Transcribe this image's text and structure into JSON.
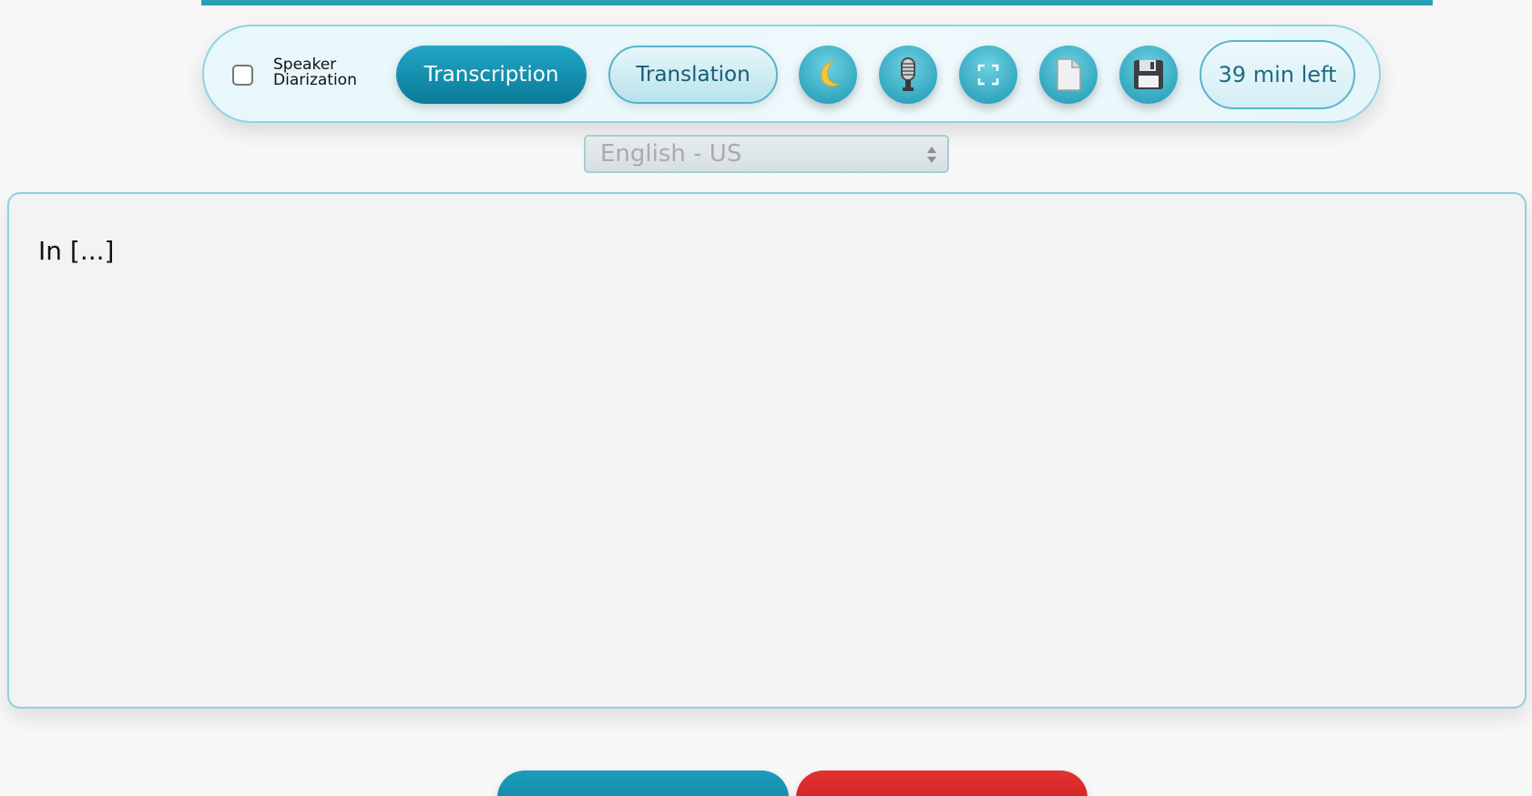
{
  "toolbar": {
    "speaker_diarization": {
      "checked": false,
      "label_line1": "Speaker",
      "label_line2": "Diarization"
    },
    "tabs": {
      "transcription": "Transcription",
      "translation": "Translation",
      "active": "Transcription"
    },
    "icons": [
      "moon-icon",
      "microphone-icon",
      "fullscreen-icon",
      "document-icon",
      "floppy-disk-icon"
    ],
    "time_left": "39 min left"
  },
  "language_select": {
    "selected": "English - US"
  },
  "transcript": {
    "text": "In [...]"
  },
  "colors": {
    "accent": "#0b7a98",
    "accent_light": "#34a9c1",
    "top_bar": "#2a9fb0",
    "danger": "#d42a2a",
    "border": "#8dd0df"
  }
}
